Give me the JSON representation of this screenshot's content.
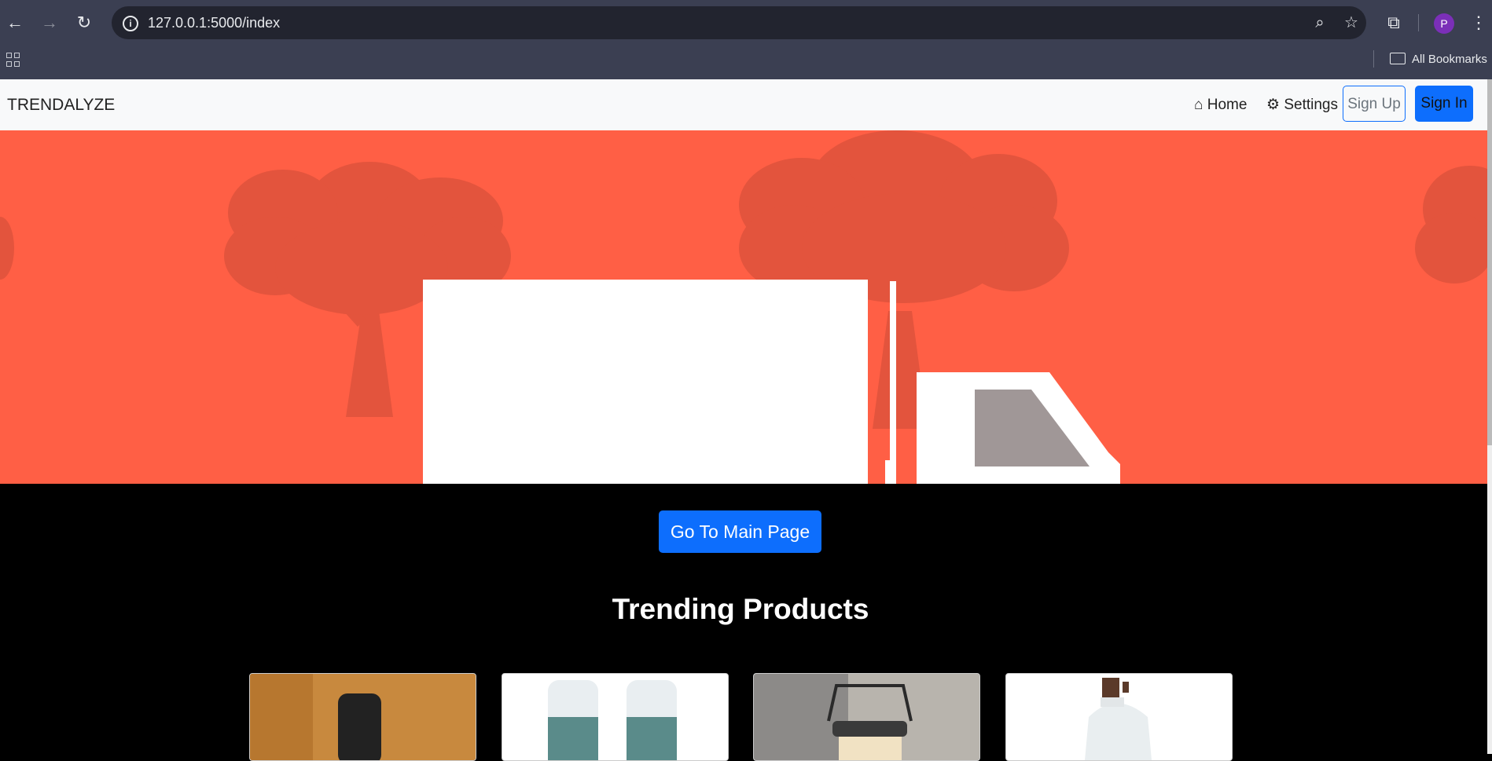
{
  "browser": {
    "url": "127.0.0.1:5000/index",
    "avatar_letter": "P",
    "bookmarks_label": "All Bookmarks"
  },
  "nav": {
    "brand": "TRENDALYZE",
    "home": "Home",
    "settings": "Settings",
    "sign_up": "Sign Up",
    "sign_in": "Sign In"
  },
  "main": {
    "go_main_button": "Go To Main Page",
    "section_title": "Trending Products"
  },
  "colors": {
    "hero_bg": "#ff5f45",
    "tree": "#e3543d",
    "primary": "#0d6efd"
  }
}
